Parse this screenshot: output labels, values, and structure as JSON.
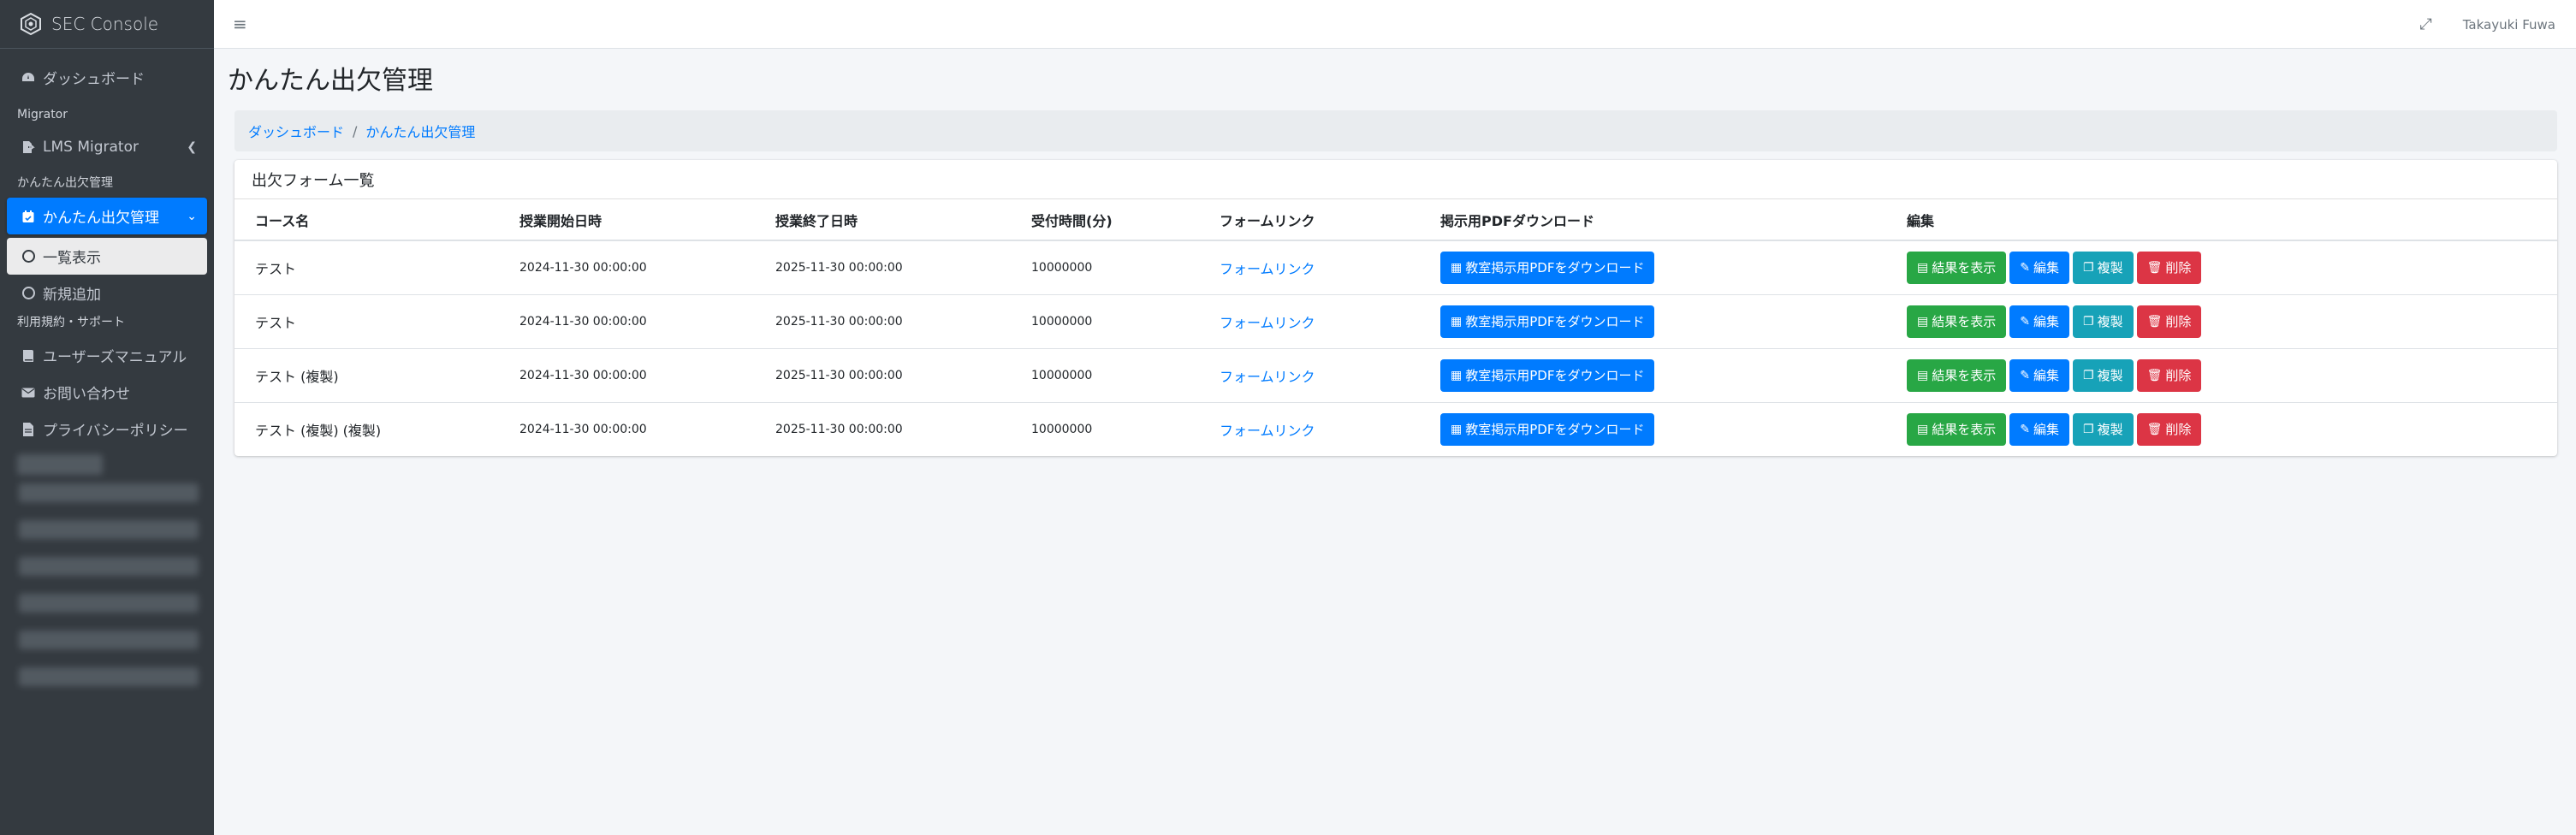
{
  "brand": {
    "name": "SEC Console"
  },
  "sidebar": {
    "items": [
      {
        "type": "item",
        "label": "ダッシュボード",
        "icon": "dashboard-icon"
      },
      {
        "type": "header",
        "label": "Migrator"
      },
      {
        "type": "item",
        "label": "LMS Migrator",
        "icon": "file-export-icon",
        "chevron": "left"
      },
      {
        "type": "header",
        "label": "かんたん出欠管理"
      },
      {
        "type": "item",
        "label": "かんたん出欠管理",
        "icon": "calendar-check-icon",
        "chevron": "down",
        "active": true
      },
      {
        "type": "sub",
        "label": "一覧表示",
        "active": true
      },
      {
        "type": "sub",
        "label": "新規追加"
      },
      {
        "type": "header",
        "label": "利用規約・サポート"
      },
      {
        "type": "item",
        "label": "ユーザーズマニュアル",
        "icon": "book-icon"
      },
      {
        "type": "item",
        "label": "お問い合わせ",
        "icon": "envelope-icon"
      },
      {
        "type": "item",
        "label": "プライバシーポリシー",
        "icon": "file-icon"
      }
    ]
  },
  "topbar": {
    "user_name": "Takayuki Fuwa"
  },
  "page": {
    "title": "かんたん出欠管理"
  },
  "breadcrumb": [
    "ダッシュボード",
    "かんたん出欠管理"
  ],
  "card": {
    "title": "出欠フォーム一覧",
    "columns": [
      "コース名",
      "授業開始日時",
      "授業終了日時",
      "受付時間(分)",
      "フォームリンク",
      "掲示用PDFダウンロード",
      "編集"
    ],
    "rows": [
      {
        "name": "テスト",
        "start": "2024-11-30 00:00:00",
        "end": "2025-11-30 00:00:00",
        "minutes": "10000000",
        "link": "フォームリンク"
      },
      {
        "name": "テスト",
        "start": "2024-11-30 00:00:00",
        "end": "2025-11-30 00:00:00",
        "minutes": "10000000",
        "link": "フォームリンク"
      },
      {
        "name": "テスト (複製)",
        "start": "2024-11-30 00:00:00",
        "end": "2025-11-30 00:00:00",
        "minutes": "10000000",
        "link": "フォームリンク"
      },
      {
        "name": "テスト (複製) (複製)",
        "start": "2024-11-30 00:00:00",
        "end": "2025-11-30 00:00:00",
        "minutes": "10000000",
        "link": "フォームリンク"
      }
    ],
    "buttons": {
      "pdf": "教室掲示用PDFをダウンロード",
      "results": "結果を表示",
      "edit": "編集",
      "copy": "複製",
      "delete": "削除"
    }
  },
  "colors": {
    "sidebar_bg": "#343a40",
    "primary": "#007bff",
    "success": "#28a745",
    "info": "#17a2b8",
    "danger": "#dc3545"
  }
}
